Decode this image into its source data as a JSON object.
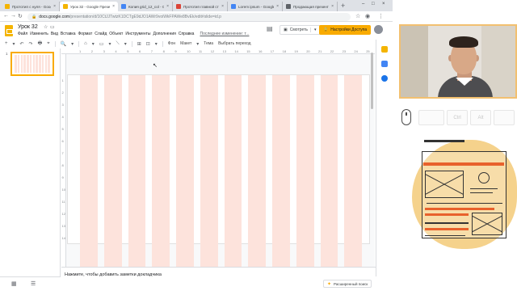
{
  "browser": {
    "tabs": [
      {
        "title": "Прототип с нуля - Goog",
        "color": "#f4b400",
        "active": false
      },
      {
        "title": "Урок 32 - Google Презен",
        "color": "#f4b400",
        "active": true
      },
      {
        "title": "Копия grid_12_col - Goo",
        "color": "#4285f4",
        "active": false
      },
      {
        "title": "Прототип главной стр",
        "color": "#db4437",
        "active": false
      },
      {
        "title": "Lorem ipsum - Google Д",
        "color": "#4285f4",
        "active": false
      },
      {
        "title": "Продающая презента",
        "color": "#5f6368",
        "active": false
      }
    ],
    "new_tab": "+",
    "window_controls": [
      "–",
      "□",
      "×"
    ],
    "url_domain": "docs.google.com",
    "url_path": "/presentation/d/10CtJJTwtzK1DCTgE9dJO1AWr9voiWkFPAWe8BvEk/edit#slide=id.p"
  },
  "app": {
    "title": "Урок 32",
    "menu": [
      "Файл",
      "Изменить",
      "Вид",
      "Вставка",
      "Формат",
      "Слайд",
      "Объект",
      "Инструменты",
      "Дополнения",
      "Справка"
    ],
    "last_edit": "Последнее изменение: т...",
    "present_label": "Смотреть",
    "share_label": "Настройки Доступа",
    "icons": {
      "star": "star-icon",
      "folder": "folder-icon",
      "comment": "comment-icon",
      "lock": "lock-icon"
    }
  },
  "toolbar": {
    "items": [
      "+",
      "▾",
      "↶",
      "↷",
      "🖶",
      "⌖",
      "🔍",
      "▾",
      "⌂",
      "▾",
      "▭",
      "▾",
      "⟍",
      "▾",
      "⊞",
      "⊡",
      "▾",
      "Фон",
      "Макет",
      "▾",
      "Тема",
      "Выбрать переход"
    ]
  },
  "filmstrip": {
    "slide_number": "1",
    "grid_view_icon": "▦",
    "list_view_icon": "☰"
  },
  "ruler": {
    "h_ticks": [
      "1",
      "2",
      "3",
      "4",
      "5",
      "6",
      "7",
      "8",
      "9",
      "10",
      "11",
      "12",
      "13",
      "14",
      "15",
      "16",
      "17",
      "18",
      "19",
      "20",
      "21",
      "22",
      "23",
      "24",
      "25"
    ],
    "v_ticks": [
      "1",
      "2",
      "3",
      "4",
      "5",
      "6",
      "7",
      "8",
      "9",
      "10",
      "11",
      "12",
      "13",
      "14"
    ]
  },
  "notes": {
    "placeholder": "Нажмите, чтобы добавить заметки докладчика",
    "explore_label": "Расширенный поиск"
  },
  "key_overlay": {
    "keys": [
      "",
      "Ctrl",
      "Alt",
      ""
    ]
  },
  "colors": {
    "grid_column": "#fde3dc",
    "accent_orange": "#f9ab00",
    "slides_yellow": "#f4b400",
    "illustration_orange": "#e8612c",
    "illustration_bg": "#f5d28c"
  }
}
